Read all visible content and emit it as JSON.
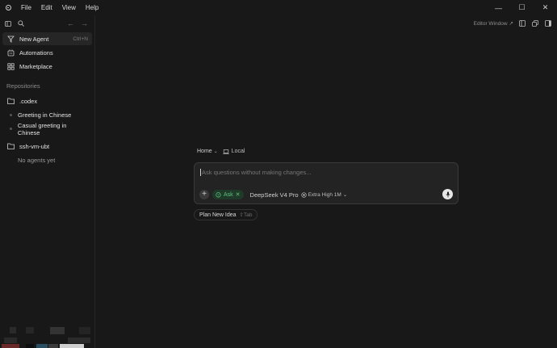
{
  "menu": [
    "File",
    "Edit",
    "View",
    "Help"
  ],
  "window_controls": {
    "minimize": "—",
    "maximize": "☐",
    "close": "✕"
  },
  "sidebar": {
    "nav": [
      {
        "label": "New Agent",
        "shortcut": "Ctrl+N",
        "icon": "new-agent-icon"
      },
      {
        "label": "Automations",
        "icon": "automations-icon"
      },
      {
        "label": "Marketplace",
        "icon": "marketplace-icon"
      }
    ],
    "section_label": "Repositories",
    "repos": [
      {
        "name": ".codex",
        "agents": [
          "Greeting in Chinese",
          "Casual greeting in Chinese"
        ]
      },
      {
        "name": "ssh-vm-ubt",
        "empty_text": "No agents yet"
      }
    ]
  },
  "main": {
    "editor_window_label": "Editor Window",
    "breadcrumb": {
      "home": "Home",
      "location": "Local"
    },
    "composer": {
      "placeholder": "Ask questions without making changes...",
      "mode": "Ask",
      "model": "DeepSeek V4 Pro",
      "effort": "Extra High 1M"
    },
    "plan_button": {
      "label": "Plan New Idea",
      "shortcut": "⇧Tab"
    }
  },
  "colors": {
    "background": "#181818",
    "accent_green": "#5fc27d",
    "composer_bg": "#232323"
  }
}
